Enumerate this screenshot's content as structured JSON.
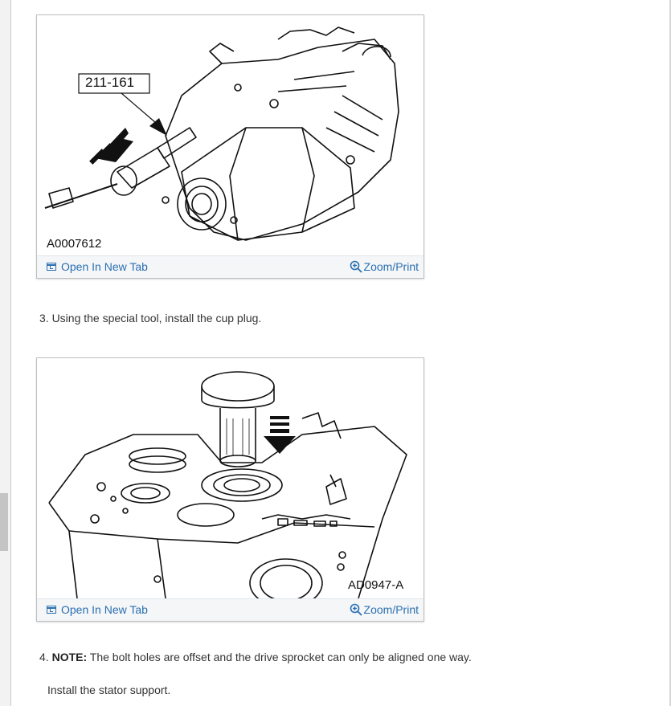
{
  "figures": [
    {
      "tool_label": "211-161",
      "figure_id": "A0007612",
      "open_label": "Open In New Tab",
      "zoom_label": "Zoom/Print"
    },
    {
      "figure_id": "AD0947-A",
      "open_label": "Open In New Tab",
      "zoom_label": "Zoom/Print"
    }
  ],
  "steps": {
    "step3": "3. Using the special tool, install the cup plug.",
    "step4_number": "4.",
    "step4_note_label": "NOTE:",
    "step4_note_text": "The bolt holes are offset and the drive sprocket can only be aligned one way.",
    "step4_instruction": "Install the stator support."
  },
  "colors": {
    "link": "#2a6fb0",
    "footer_bg": "#f4f6f8"
  }
}
